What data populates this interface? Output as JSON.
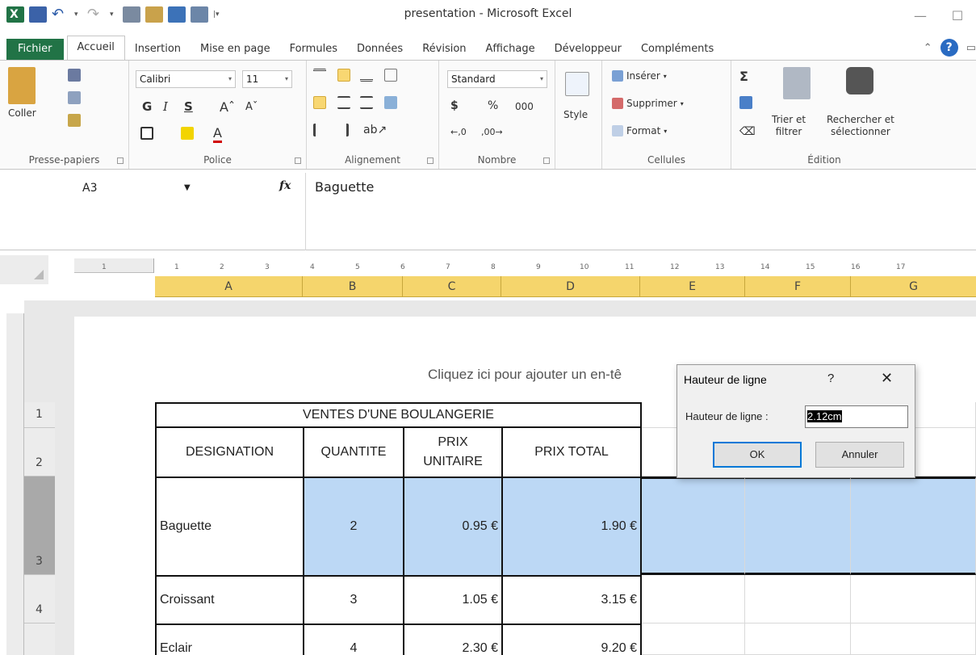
{
  "app": {
    "title": "presentation - Microsoft Excel",
    "minimize": "—",
    "maximize": "☐"
  },
  "tabs": [
    {
      "label": "Fichier"
    },
    {
      "label": "Accueil"
    },
    {
      "label": "Insertion"
    },
    {
      "label": "Mise en page"
    },
    {
      "label": "Formules"
    },
    {
      "label": "Données"
    },
    {
      "label": "Révision"
    },
    {
      "label": "Affichage"
    },
    {
      "label": "Développeur"
    },
    {
      "label": "Compléments"
    }
  ],
  "ribbon": {
    "clipboard": {
      "label": "Presse-papiers",
      "paste": "Coller"
    },
    "font": {
      "label": "Police",
      "name": "Calibri",
      "size": "11",
      "bold": "G",
      "italic": "I",
      "underline": "S"
    },
    "alignment": {
      "label": "Alignement"
    },
    "number": {
      "label": "Nombre",
      "format": "Standard",
      "currency": "$",
      "percent": "%",
      "thousands": "000"
    },
    "style": {
      "label": "Style"
    },
    "cells": {
      "label": "Cellules",
      "insert": "Insérer",
      "delete": "Supprimer",
      "format": "Format"
    },
    "editing": {
      "label": "Édition",
      "sort1": "Trier et",
      "sort2": "filtrer",
      "find1": "Rechercher et",
      "find2": "sélectionner"
    }
  },
  "formula_bar": {
    "name_box": "A3",
    "fx": "fx",
    "value": "Baguette"
  },
  "ruler_ticks": [
    "1",
    "1",
    "2",
    "3",
    "4",
    "5",
    "6",
    "7",
    "8",
    "9",
    "10",
    "11",
    "12",
    "13",
    "14",
    "15",
    "16",
    "17"
  ],
  "columns": [
    "A",
    "B",
    "C",
    "D",
    "E",
    "F",
    "G"
  ],
  "rows": [
    "1",
    "2",
    "3",
    "4"
  ],
  "header_hint": "Cliquez ici pour ajouter un en-tê",
  "table": {
    "title": "VENTES D'UNE BOULANGERIE",
    "headers": [
      "DESIGNATION",
      "QUANTITE",
      "PRIX UNITAIRE",
      "PRIX TOTAL"
    ],
    "rows": [
      [
        "Baguette",
        "2",
        "0.95 €",
        "1.90 €"
      ],
      [
        "Croissant",
        "3",
        "1.05 €",
        "3.15 €"
      ],
      [
        "Eclair",
        "4",
        "2.30 €",
        "9.20 €"
      ]
    ]
  },
  "dialog": {
    "title": "Hauteur de ligne",
    "help": "?",
    "close": "✕",
    "label": "Hauteur de ligne :",
    "value": "2.12cm",
    "ok": "OK",
    "cancel": "Annuler"
  },
  "colors": {
    "file_tab": "#217346",
    "column_header_selected": "#f5d56c",
    "cell_selection": "#bcd8f5",
    "row_header_selected": "#a9a9a9",
    "ok_focus": "#0078d7"
  }
}
